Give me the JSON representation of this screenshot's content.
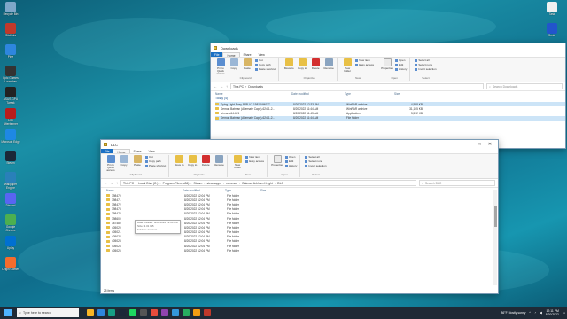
{
  "desktop": {
    "left_icons": [
      {
        "label": "Recycle Bin",
        "color": "#7fa7c9"
      },
      {
        "label": "Sitelinks",
        "color": "#c0392b"
      },
      {
        "label": "Pine",
        "color": "#2e86de"
      },
      {
        "label": "Epic Games Launcher",
        "color": "#333333"
      },
      {
        "label": "ASUS GPU Tweak",
        "color": "#222222"
      },
      {
        "label": "MSI Afterburner",
        "color": "#b71c1c"
      },
      {
        "label": "Microsoft Edge",
        "color": "#1e88e5"
      },
      {
        "label": "Steam",
        "color": "#1b2838"
      },
      {
        "label": "Wallpaper Engine",
        "color": "#2980b9"
      },
      {
        "label": "Discord",
        "color": "#5865f2"
      },
      {
        "label": "Google Chrome",
        "color": "#4caf50"
      },
      {
        "label": "Uplay",
        "color": "#0070d1"
      },
      {
        "label": "Origin Games",
        "color": "#f56c2d"
      }
    ],
    "right_icons": [
      {
        "label": "Task",
        "color": "#f0f0f0"
      },
      {
        "label": "Sonic",
        "color": "#2255cc"
      }
    ]
  },
  "downloads_window": {
    "title": "Downloads",
    "tabs": [
      "File",
      "Home",
      "Share",
      "View"
    ],
    "ribbon": {
      "pin_label": "Pin to Quick access",
      "copy_label": "Copy",
      "paste_label": "Paste",
      "cut_label": "Cut",
      "copy_path_label": "Copy path",
      "paste_shortcut_label": "Paste shortcut",
      "move_to_label": "Move to",
      "copy_to_label": "Copy to",
      "delete_label": "Delete",
      "rename_label": "Rename",
      "new_item_label": "New item",
      "easy_access_label": "Easy access",
      "new_folder_label": "New folder",
      "properties_label": "Properties",
      "open_label": "Open",
      "edit_label": "Edit",
      "history_label": "History",
      "select_all_label": "Select all",
      "select_none_label": "Select none",
      "invert_selection_label": "Invert selection",
      "group_clipboard": "Clipboard",
      "group_organize": "Organize",
      "group_new": "New",
      "group_open": "Open",
      "group_select": "Select"
    },
    "path": [
      "This PC",
      "Downloads"
    ],
    "search_placeholder": "Search Downloads",
    "columns": [
      "Name",
      "Date modified",
      "Type",
      "Size"
    ],
    "group_header": "Today (4)",
    "rows": [
      {
        "name": "Dying.Light.Easy-B2B-V1-198124M017",
        "date": "8/20/2022 12:33 PM",
        "type": "WinRAR archive",
        "size": "4,598 KB",
        "selected": true
      },
      {
        "name": "Demon Batman (Alternate Cape)-624-1-2...",
        "date": "8/20/2022 11:44 AM",
        "type": "WinRAR archive",
        "size": "31,105 KB",
        "selected": false
      },
      {
        "name": "winrar-x64-621",
        "date": "8/20/2022 11:43 AM",
        "type": "Application",
        "size": "3,512 KB",
        "selected": false
      },
      {
        "name": "Demon Batman (Alternate Cape)-624-1-2...",
        "date": "8/20/2022 11:44 AM",
        "type": "File folder",
        "size": "",
        "selected": true
      }
    ]
  },
  "dlc_window": {
    "title": "DLC",
    "tabs": [
      "File",
      "Home",
      "Share",
      "View"
    ],
    "path": [
      "This PC",
      "Local Disk (C:)",
      "Program Files (x86)",
      "Steam",
      "steamapps",
      "common",
      "Batman Arkham Knight",
      "DLC"
    ],
    "search_placeholder": "Search DLC",
    "columns": [
      "Name",
      "Date modified",
      "Type",
      "Size"
    ],
    "rows": [
      {
        "name": "398470",
        "date": "8/20/2022 12:04 PM",
        "type": "File folder"
      },
      {
        "name": "398471",
        "date": "8/20/2022 12:04 PM",
        "type": "File folder"
      },
      {
        "name": "398472",
        "date": "8/20/2022 12:04 PM",
        "type": "File folder"
      },
      {
        "name": "398473",
        "date": "8/20/2022 12:04 PM",
        "type": "File folder"
      },
      {
        "name": "398474",
        "date": "8/20/2022 12:04 PM",
        "type": "File folder"
      },
      {
        "name": "398600",
        "date": "8/20/2022 12:04 PM",
        "type": "File folder"
      },
      {
        "name": "387480",
        "date": "8/20/2022 12:04 PM",
        "type": "File folder"
      },
      {
        "name": "405020",
        "date": "8/20/2022 12:04 PM",
        "type": "File folder"
      },
      {
        "name": "405021",
        "date": "8/20/2022 12:04 PM",
        "type": "File folder"
      },
      {
        "name": "405022",
        "date": "8/20/2022 12:04 PM",
        "type": "File folder"
      },
      {
        "name": "405023",
        "date": "8/20/2022 12:04 PM",
        "type": "File folder"
      },
      {
        "name": "405024",
        "date": "8/20/2022 12:04 PM",
        "type": "File folder"
      },
      {
        "name": "405025",
        "date": "8/20/2022 12:04 PM",
        "type": "File folder"
      }
    ],
    "tooltip": {
      "created": "Date created: 8/20/2022 12:03 PM",
      "size": "Size: 3.31 GB",
      "content": "Folders: Content"
    },
    "status": "25 items"
  },
  "taskbar": {
    "search_placeholder": "Type here to search",
    "weather": "86°F Mostly sunny",
    "time": "12:11 PM",
    "date": "8/20/2022",
    "app_colors": [
      "#f9b626",
      "#2e86de",
      "#16a085",
      "#1b2838",
      "#1ed760",
      "#555555",
      "#e74c3c",
      "#8e44ad",
      "#3498db",
      "#27ae60",
      "#f39c12",
      "#c0392b"
    ]
  }
}
